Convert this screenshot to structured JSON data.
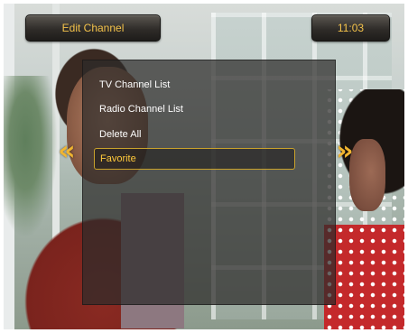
{
  "header": {
    "title": "Edit Channel",
    "clock": "11:03"
  },
  "menu": {
    "items": [
      {
        "label": "TV Channel List",
        "selected": false
      },
      {
        "label": "Radio Channel List",
        "selected": false
      },
      {
        "label": "Delete All",
        "selected": false
      },
      {
        "label": "Favorite",
        "selected": true
      }
    ]
  },
  "nav": {
    "left_icon": "double-chevron-left-icon",
    "right_icon": "double-chevron-right-icon",
    "left_glyph": "«",
    "right_glyph": "»"
  },
  "colors": {
    "accent": "#f3c24a",
    "selection_border": "#c9a22c",
    "menu_text": "#ffffff"
  }
}
